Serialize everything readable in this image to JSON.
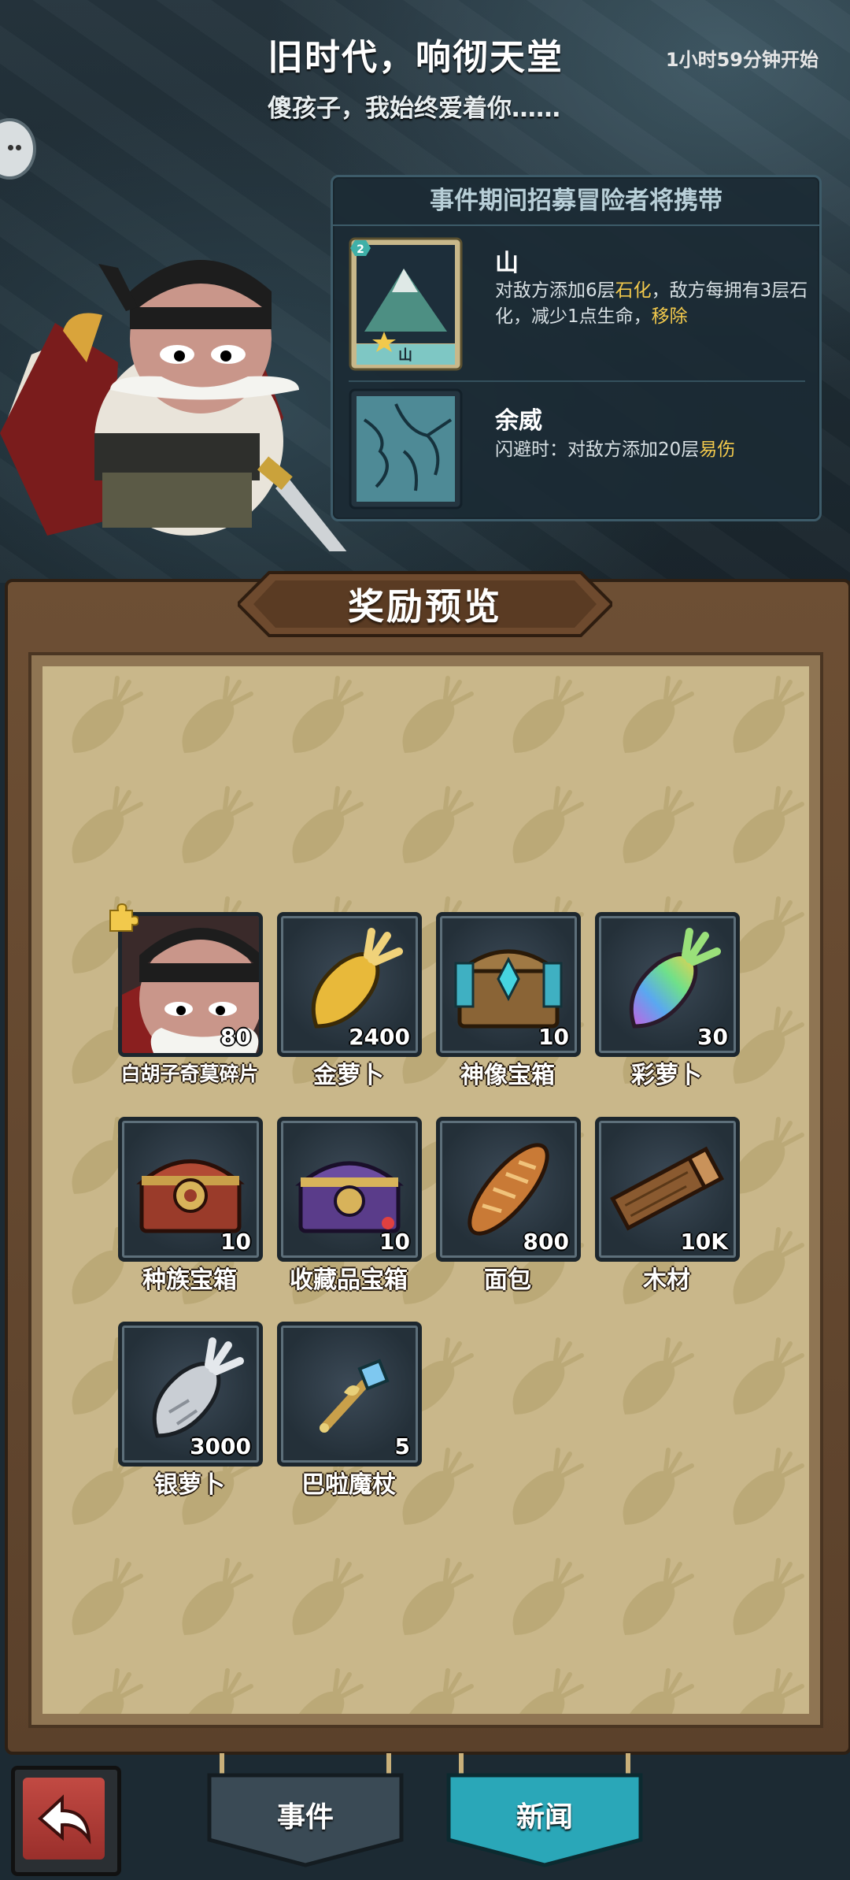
{
  "header": {
    "title": "旧时代，响彻天堂",
    "subtitle": "傻孩子，我始终爱着你……",
    "countdown": "1小时59分钟开始"
  },
  "event_panel": {
    "heading": "事件期间招募冒险者将携带",
    "traits": [
      {
        "name": "山",
        "card_level": "2",
        "card_caption": "山",
        "desc_parts": [
          "对敌方添加6层",
          "石化",
          "，敌方每拥有3层石化，减少1点生命，",
          "移除"
        ]
      },
      {
        "name": "余威",
        "desc_parts": [
          "闪避时：对敌方添加20层",
          "易伤"
        ]
      }
    ]
  },
  "rewards": {
    "title": "奖励预览",
    "items": [
      {
        "name": "白胡子奇莫碎片",
        "count": "80",
        "icon": "whitebeard-portrait-icon"
      },
      {
        "name": "金萝卜",
        "count": "2400",
        "icon": "gold-carrot-icon"
      },
      {
        "name": "神像宝箱",
        "count": "10",
        "icon": "statue-chest-icon"
      },
      {
        "name": "彩萝卜",
        "count": "30",
        "icon": "rainbow-carrot-icon"
      },
      {
        "name": "种族宝箱",
        "count": "10",
        "icon": "race-chest-icon"
      },
      {
        "name": "收藏品宝箱",
        "count": "10",
        "icon": "collectible-chest-icon"
      },
      {
        "name": "面包",
        "count": "800",
        "icon": "bread-icon"
      },
      {
        "name": "木材",
        "count": "10K",
        "icon": "wood-icon"
      },
      {
        "name": "银萝卜",
        "count": "3000",
        "icon": "silver-carrot-icon"
      },
      {
        "name": "巴啦魔杖",
        "count": "5",
        "icon": "magic-wand-icon"
      }
    ]
  },
  "nav": {
    "back_icon": "back-arrow-icon",
    "tabs": [
      {
        "label": "事件",
        "active": false
      },
      {
        "label": "新闻",
        "active": true
      }
    ]
  },
  "colors": {
    "highlight": "#f2c94c",
    "active_tab": "#2aa7b8",
    "inactive_tab": "#3a4a55"
  }
}
